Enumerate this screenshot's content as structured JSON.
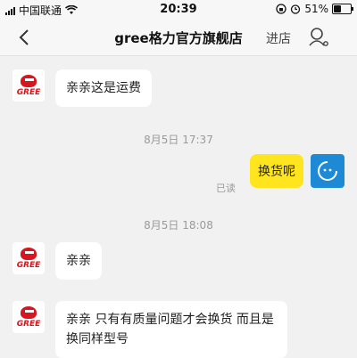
{
  "status_bar": {
    "carrier": "中国联通",
    "time": "20:39",
    "battery": "51%",
    "battery_level": 0.51
  },
  "nav": {
    "title": "gree格力官方旗舰店",
    "store_label": "进店",
    "back_icon": "chevron-left-icon",
    "profile_icon": "user-profile-icon"
  },
  "brand": {
    "avatar_text": "GREE",
    "color": "#d7161f"
  },
  "messages": [
    {
      "from": "shop",
      "text": "亲亲这是运费"
    },
    {
      "type": "time",
      "text": "8月5日 17:37"
    },
    {
      "from": "me",
      "text": "换货呢",
      "status": "已读"
    },
    {
      "type": "time",
      "text": "8月5日 18:08"
    },
    {
      "from": "shop",
      "text": "亲亲"
    },
    {
      "from": "shop",
      "text": "亲亲 只有有质量问题才会换货 而且是换同样型号"
    }
  ],
  "colors": {
    "my_bubble": "#ffe51e",
    "my_avatar": "#1e8ad6",
    "background": "#f1f1f1"
  }
}
